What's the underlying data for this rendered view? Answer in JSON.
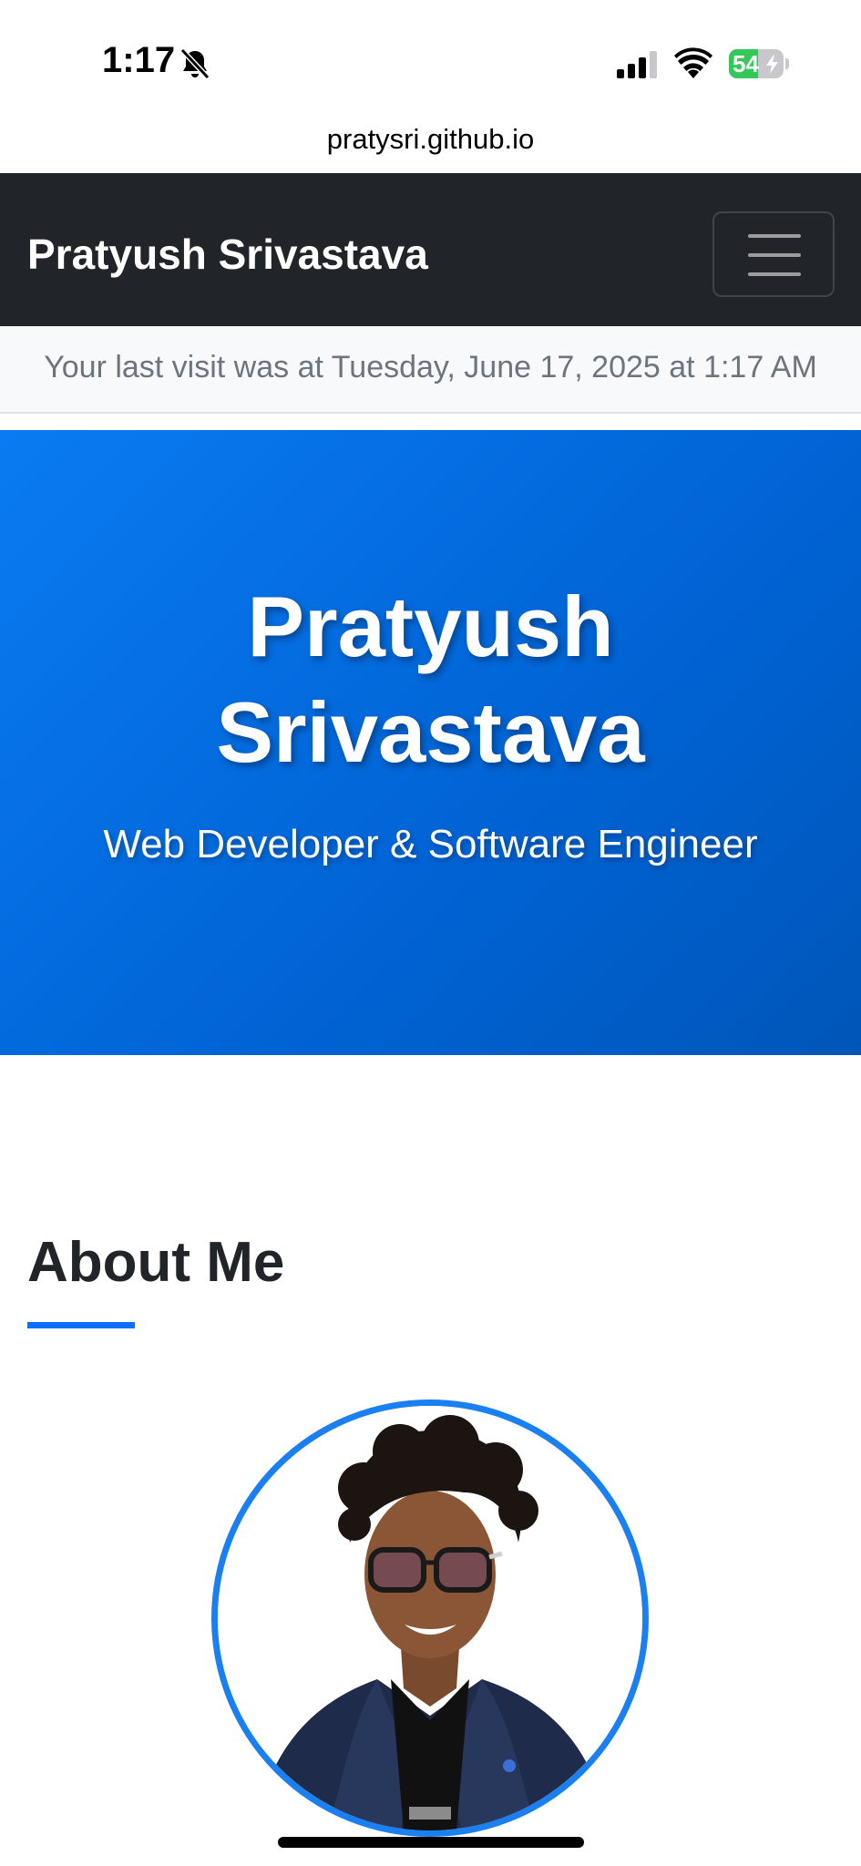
{
  "status_bar": {
    "time": "1:17",
    "battery_percent": "54",
    "battery_level": 0.54,
    "icons": [
      "bell-slash-icon",
      "cellular-signal-icon",
      "wifi-icon",
      "battery-charging-icon"
    ]
  },
  "browser": {
    "url": "pratysri.github.io"
  },
  "navbar": {
    "brand": "Pratyush Srivastava",
    "toggler_icon": "hamburger-menu-icon"
  },
  "visit_banner": {
    "text": "Your last visit was at Tuesday, June 17, 2025 at 1:17 AM"
  },
  "hero": {
    "title_line1": "Pratyush",
    "title_line2": "Srivastava",
    "subtitle": "Web Developer & Software Engineer"
  },
  "about": {
    "heading": "About Me"
  },
  "colors": {
    "navbar_bg": "#212529",
    "hero_accent": "#0a7bf2",
    "underline": "#0d6efd",
    "avatar_border": "#1a7ff0",
    "banner_text": "#6c757d"
  }
}
